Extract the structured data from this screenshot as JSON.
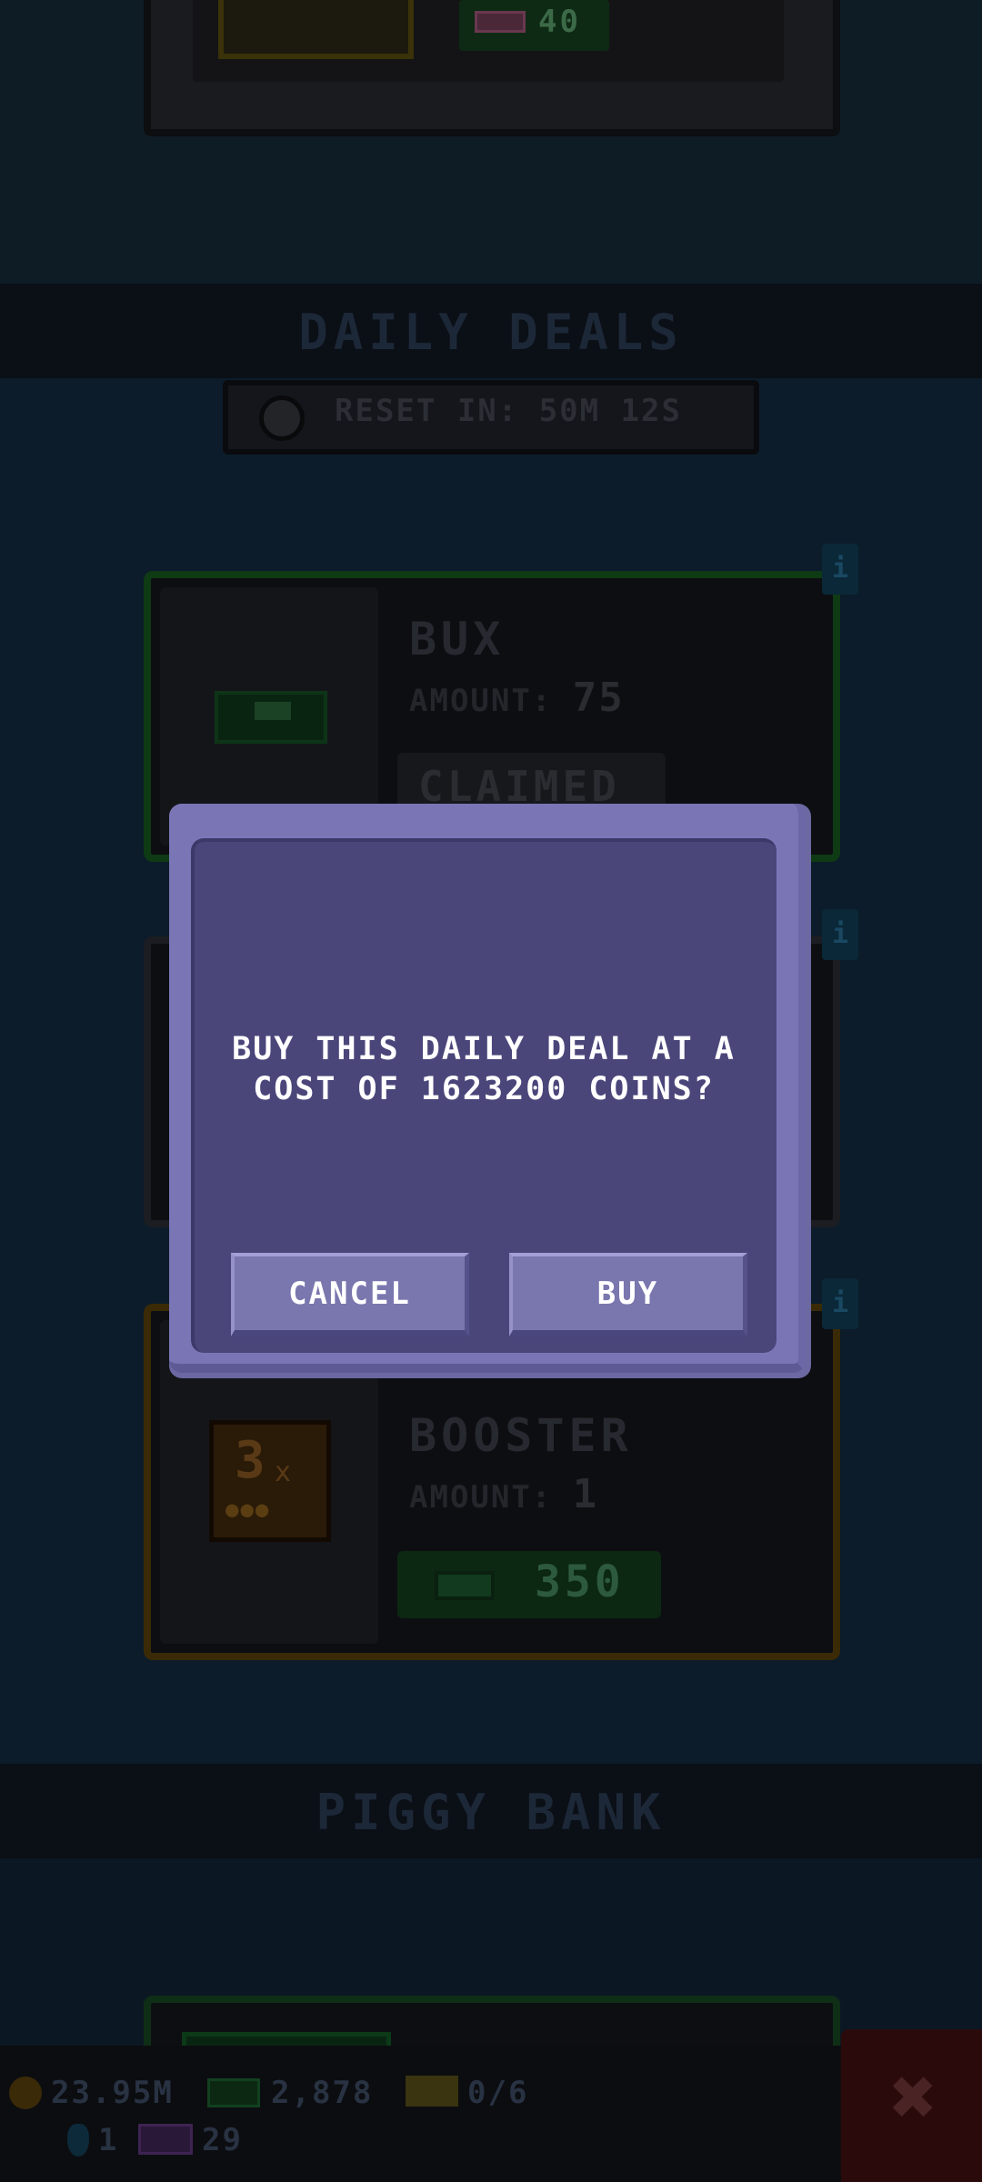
{
  "previous_card": {
    "price": "40"
  },
  "daily_deals": {
    "title": "DAILY DEALS",
    "reset_text": "RESET IN: 50M 12S",
    "deals": [
      {
        "name": "BUX",
        "amount_label": "AMOUNT:",
        "amount": "75",
        "status": "CLAIMED"
      },
      {
        "name_line2": "BOOSTER",
        "amount_label": "AMOUNT:",
        "amount": "1",
        "icon_label": "3",
        "icon_x": "x",
        "price": "350"
      }
    ],
    "info_label": "i"
  },
  "piggy_bank": {
    "title": "PIGGY BANK"
  },
  "hud": {
    "coins": "23.95M",
    "bux": "2,878",
    "tickets": "0/6",
    "gems": "1",
    "tv": "29"
  },
  "dialog": {
    "message_line1": "BUY THIS DAILY DEAL AT A",
    "message_line2": "COST OF 1623200 COINS?",
    "cancel_label": "CANCEL",
    "buy_label": "BUY"
  },
  "close_label": "✖"
}
